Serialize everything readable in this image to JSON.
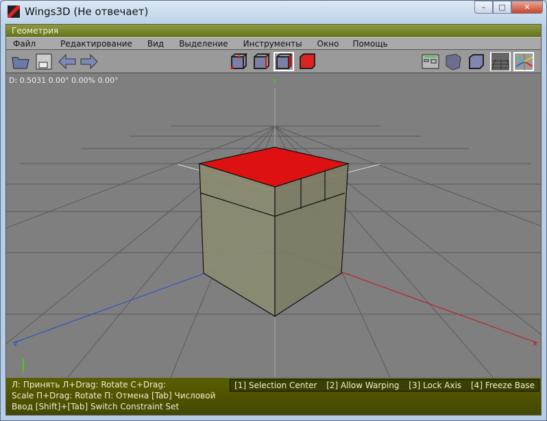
{
  "window": {
    "title": "Wings3D (Не отвечает)",
    "minimize": "–",
    "maximize": "□",
    "close": "✕"
  },
  "mode_bar": {
    "label": "Геометрия"
  },
  "menu": [
    "Файл",
    "Редактирование",
    "Вид",
    "Выделение",
    "Инструменты",
    "Окно",
    "Помощь"
  ],
  "info": "D: 0.5031  0.00°  0.00%  0.00°",
  "axes": {
    "x": "x",
    "y": "y",
    "z": "z"
  },
  "status": {
    "line1": "Л: Принять   Л+Drag: Rotate   С+Drag:",
    "line2": "Scale   П+Drag: Rotate   П: Отмена   [Tab] Числовой",
    "line3": "Ввод   [Shift]+[Tab] Switch Constraint Set",
    "constraints": [
      "[1] Selection Center",
      "[2] Allow Warping",
      "[3] Lock Axis",
      "[4] Freeze Base"
    ]
  },
  "colors": {
    "selection": "#dd1111",
    "statusbar": "#4a4e00",
    "x_axis": "#cc1111",
    "z_axis": "#1144cc",
    "y_axis": "#44cc22"
  }
}
